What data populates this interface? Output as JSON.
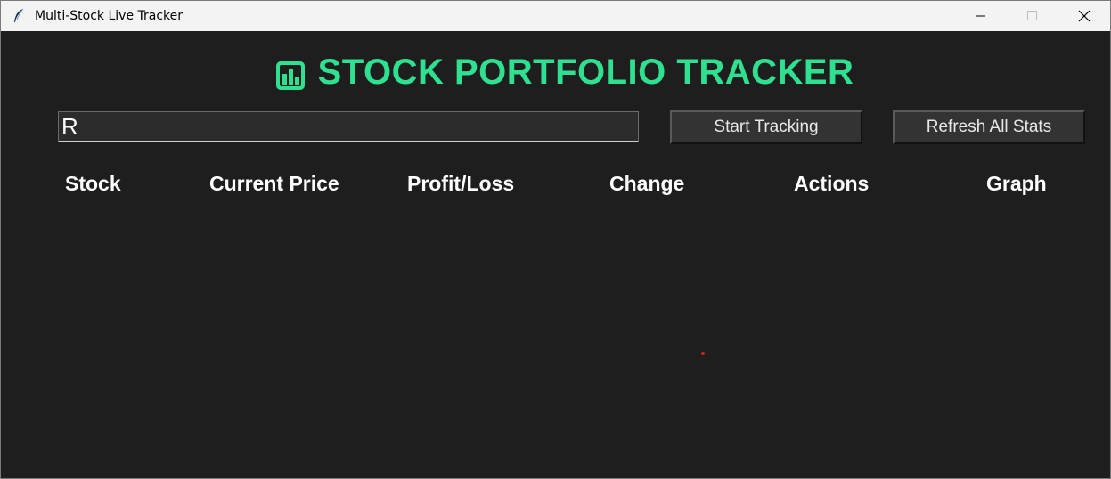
{
  "window": {
    "title": "Multi-Stock Live Tracker"
  },
  "header": {
    "title": "STOCK PORTFOLIO TRACKER",
    "icon": "bar-chart-icon",
    "accent_color": "#2ee08f"
  },
  "search": {
    "value": "R"
  },
  "buttons": {
    "start": "Start Tracking",
    "refresh": "Refresh All Stats"
  },
  "table": {
    "columns": [
      "Stock",
      "Current Price",
      "Profit/Loss",
      "Change",
      "Actions",
      "Graph"
    ],
    "rows": []
  },
  "colors": {
    "background": "#1e1e1e",
    "entry_bg": "#2c2c2c",
    "button_bg": "#333333"
  }
}
